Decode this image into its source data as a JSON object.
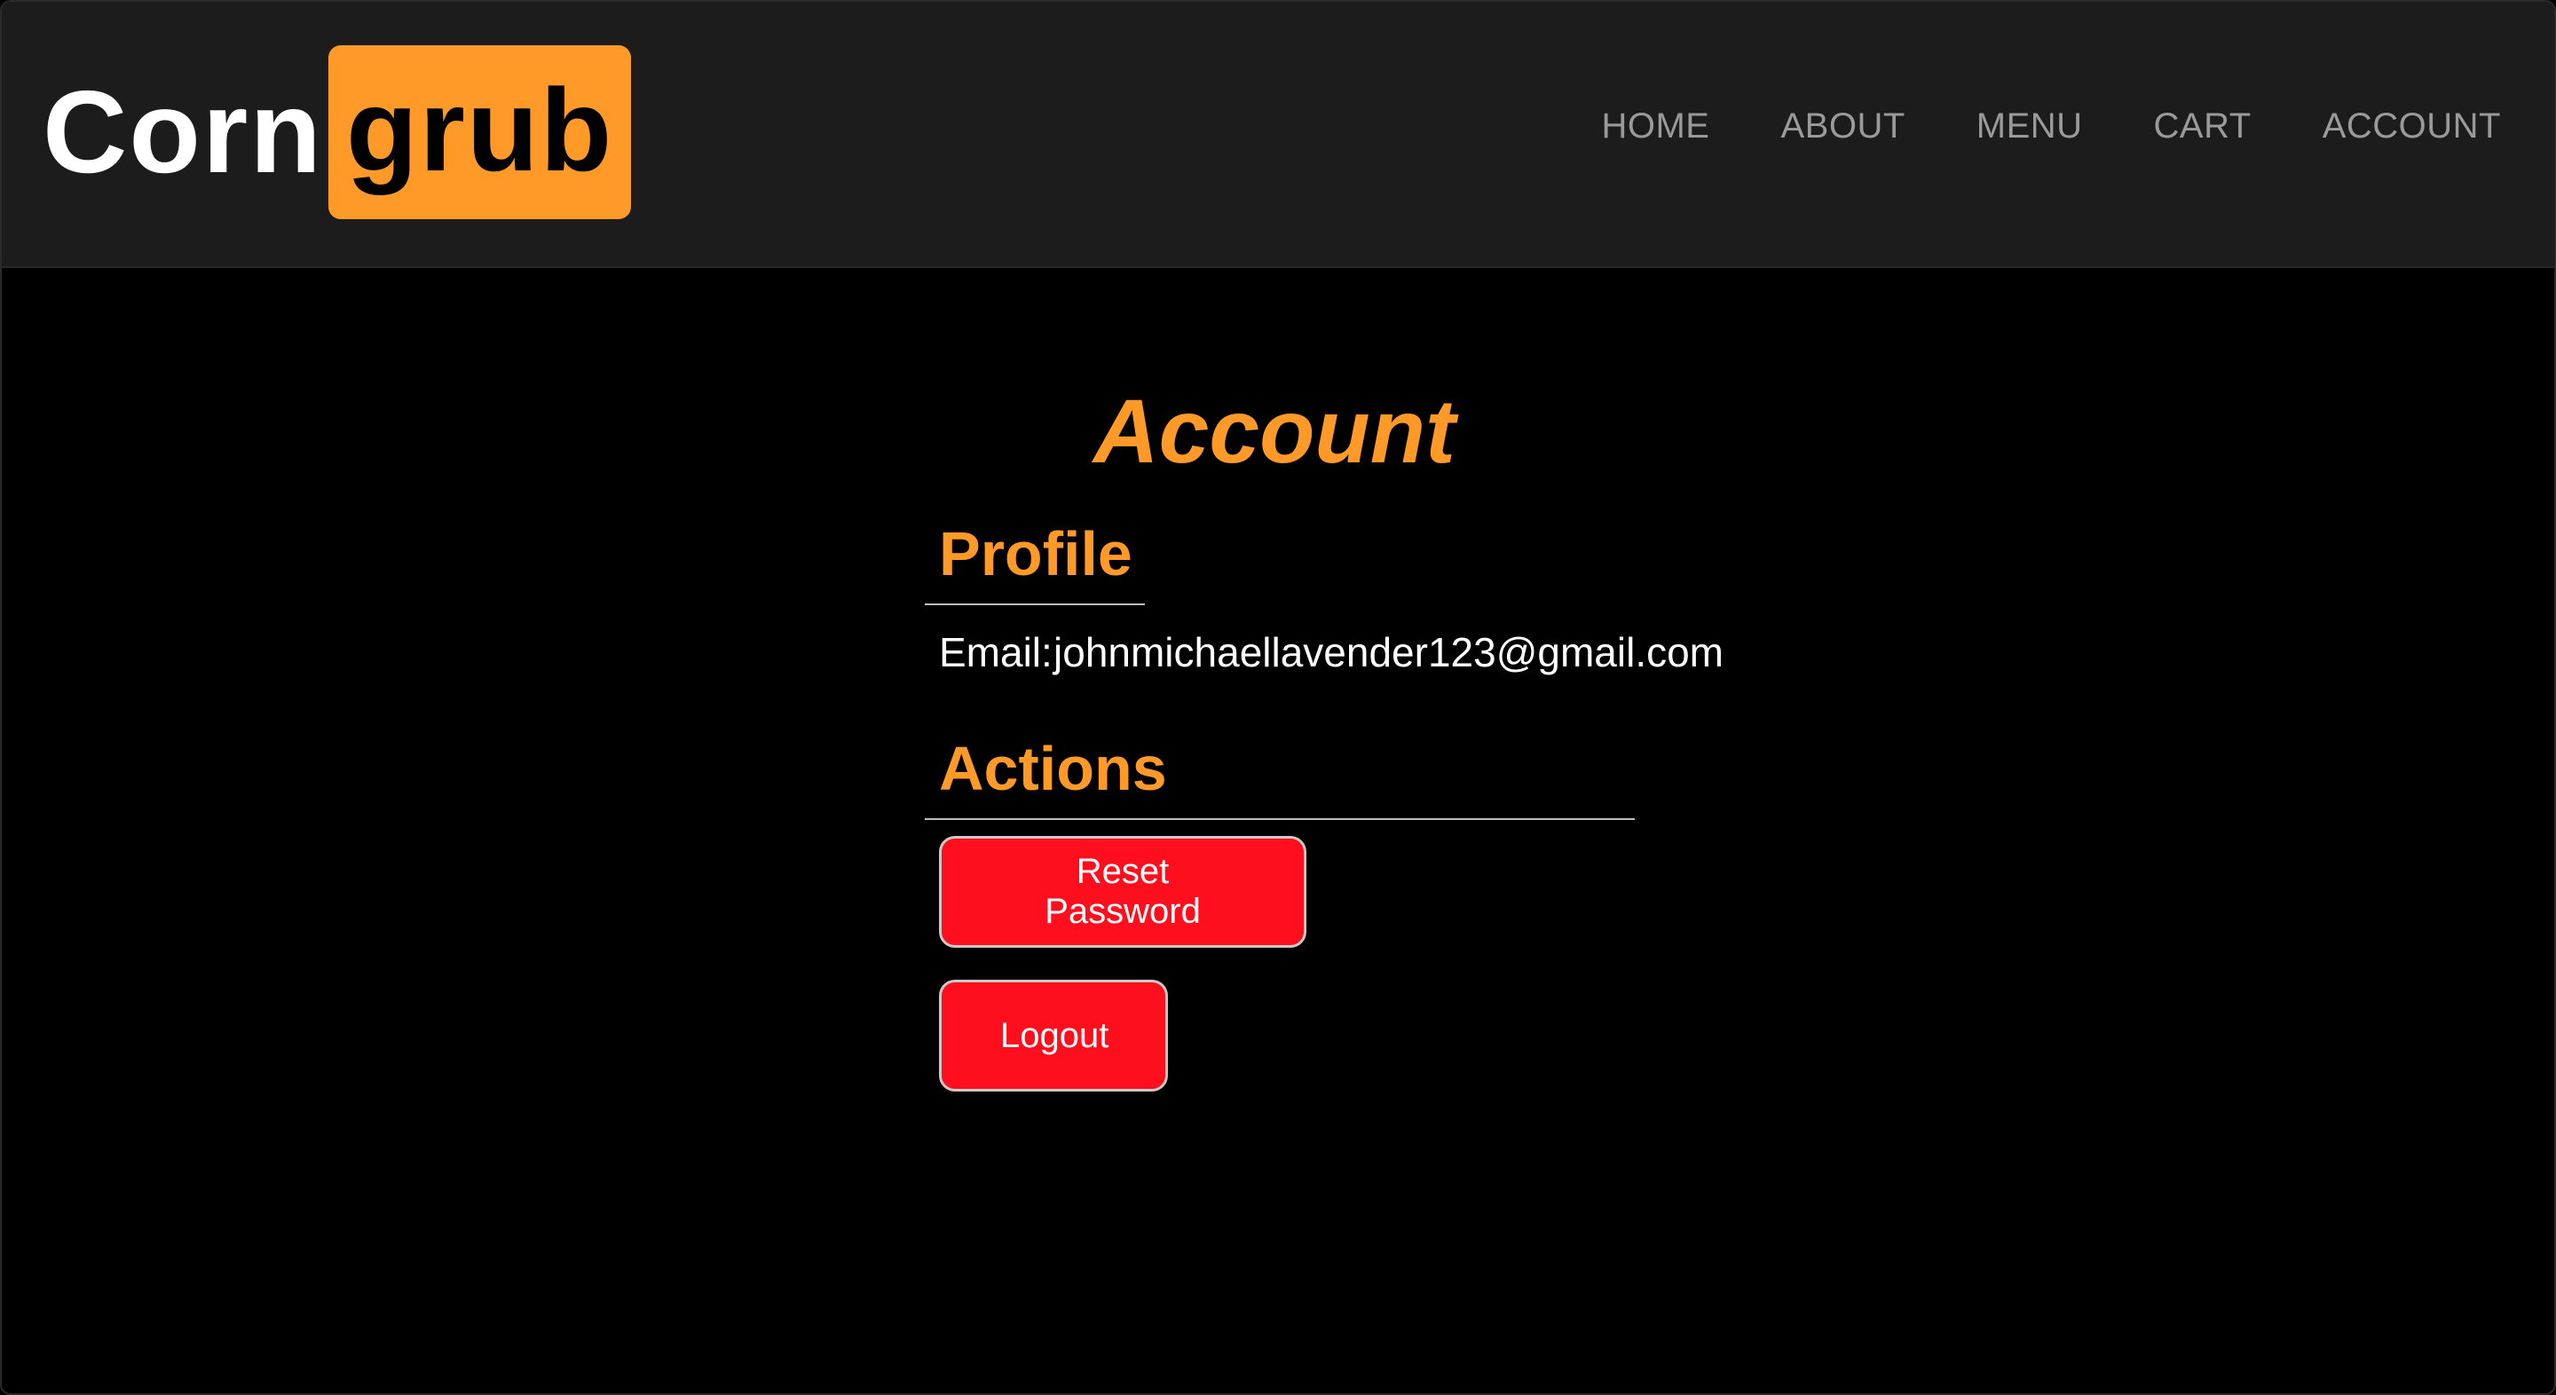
{
  "brand": {
    "part1": "Corn",
    "part2": "grub",
    "accent_color": "#ff9a29"
  },
  "nav": {
    "items": [
      {
        "label": "HOME"
      },
      {
        "label": "ABOUT"
      },
      {
        "label": "MENU"
      },
      {
        "label": "CART"
      },
      {
        "label": "ACCOUNT"
      }
    ]
  },
  "page": {
    "title": "Account"
  },
  "profile": {
    "heading": "Profile",
    "email_label": "Email:",
    "email_value": "johnmichaellavender123@gmail.com"
  },
  "actions": {
    "heading": "Actions",
    "reset_password_label": "Reset Password",
    "logout_label": "Logout",
    "button_color": "#ff0e1d"
  }
}
